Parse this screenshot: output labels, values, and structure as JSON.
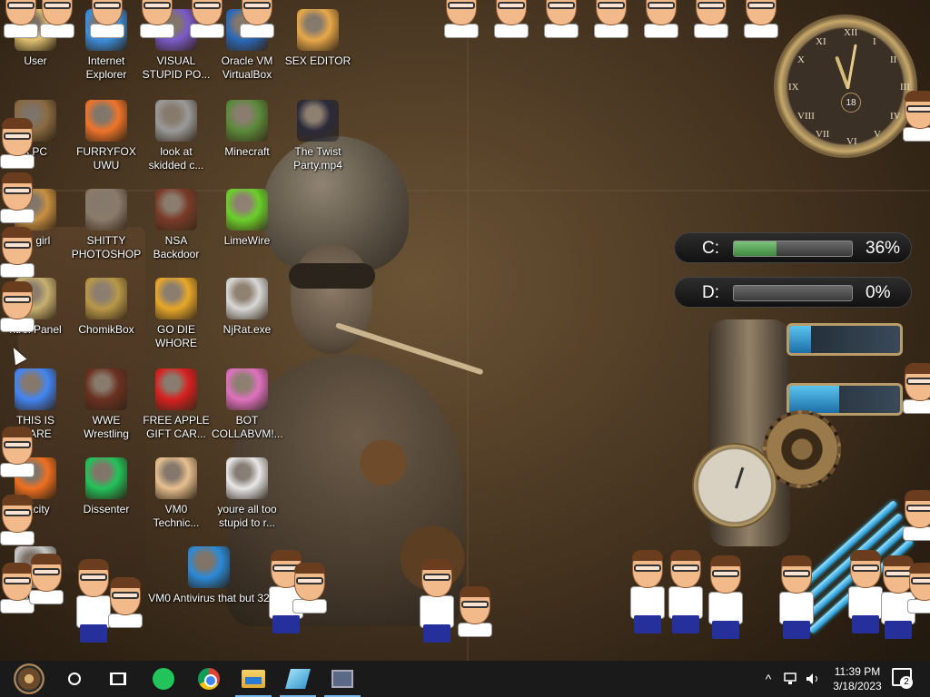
{
  "desktop": {
    "icons": [
      {
        "label": "User",
        "icon": "user-folder-icon",
        "color": "#e0c070"
      },
      {
        "label": "Internet\nExplorer",
        "icon": "internet-explorer-icon",
        "color": "#3c8fde"
      },
      {
        "label": "VISUAL\nSTUPID PO...",
        "icon": "visual-studio-icon",
        "color": "#7a5ac8"
      },
      {
        "label": "Oracle VM\nVirtualBox",
        "icon": "virtualbox-icon",
        "color": "#2a68b8"
      },
      {
        "label": "SEX EDITOR",
        "icon": "hex-editor-icon",
        "color": "#e8a848"
      },
      {
        "label": "s PC",
        "icon": "this-pc-icon",
        "color": "#8a6a40"
      },
      {
        "label": "FURRYFOX\nUWU",
        "icon": "firefox-icon",
        "color": "#f0742a"
      },
      {
        "label": "look at\nskidded c...",
        "icon": "copy-documents-icon",
        "color": "#9a9a9a"
      },
      {
        "label": "Minecraft",
        "icon": "minecraft-icon",
        "color": "#5a8a3a"
      },
      {
        "label": "The Twist\nParty.mp4",
        "icon": "video-file-icon",
        "color": "#2a2a3a"
      },
      {
        "label": "on girl",
        "icon": "cartoon-folder-icon",
        "color": "#c89040"
      },
      {
        "label": "SHITTY\nPHOTOSHOP",
        "icon": "gimp-icon",
        "color": "#8a7a6a"
      },
      {
        "label": "NSA\nBackdoor",
        "icon": "nsa-backdoor-icon",
        "color": "#7a3a28"
      },
      {
        "label": "LimeWire",
        "icon": "limewire-icon",
        "color": "#6ad02a"
      },
      {
        "label": "ntrol Panel",
        "icon": "control-panel-icon",
        "color": "#c8b070"
      },
      {
        "label": "ChomikBox",
        "icon": "chomikbox-icon",
        "color": "#b89848"
      },
      {
        "label": "GO DIE\nWHORE",
        "icon": "de-app-icon",
        "color": "#e8a828"
      },
      {
        "label": "NjRat.exe",
        "icon": "skull-icon",
        "color": "#d8d8d8"
      },
      {
        "label": "THIS IS\nWARE",
        "icon": "chrome-icon",
        "color": "#4285f4"
      },
      {
        "label": "WWE\nWrestling",
        "icon": "tv-icon",
        "color": "#6a3020"
      },
      {
        "label": "FREE APPLE\nGIFT CAR...",
        "icon": "apple-icon",
        "color": "#d82020"
      },
      {
        "label": "BOT\nCOLLABVM!...",
        "icon": "monitor-icon",
        "color": "#e070c0"
      },
      {
        "label": "dacity",
        "icon": "audacity-icon",
        "color": "#f07020"
      },
      {
        "label": "Dissenter",
        "icon": "dissenter-icon",
        "color": "#22c35a"
      },
      {
        "label": "VM0\nTechnic...",
        "icon": "technician-icon",
        "color": "#e8c090"
      },
      {
        "label": "youre all too\nstupid to r...",
        "icon": "portrait-image-icon",
        "color": "#e8e8e8"
      },
      {
        "label": "ALE",
        "icon": "partial-icon",
        "color": "#c8c8c8"
      },
      {
        "label": "VM0 Antivirus that but 32",
        "icon": "shield-icon",
        "color": "#2a8ad8"
      }
    ]
  },
  "widgets": {
    "clock": {
      "numerals": [
        "XII",
        "III",
        "VI",
        "IX",
        "I",
        "II",
        "IV",
        "V",
        "VII",
        "VIII",
        "X",
        "XI"
      ],
      "date_day": "18"
    },
    "drives": [
      {
        "label": "C:",
        "percent_text": "36%",
        "fill": 0.36
      },
      {
        "label": "D:",
        "percent_text": "0%",
        "fill": 0.0
      }
    ],
    "tubes": [
      {
        "level": 0.2
      },
      {
        "level": 0.45
      }
    ]
  },
  "taskbar": {
    "pinned": [
      {
        "name": "start-button",
        "icon": "start-orb-icon"
      },
      {
        "name": "cortana-button",
        "icon": "cortana-circle-icon"
      },
      {
        "name": "task-view-button",
        "icon": "task-view-icon"
      },
      {
        "name": "dissenter-taskbar",
        "icon": "dissenter-icon"
      },
      {
        "name": "chrome-taskbar",
        "icon": "chrome-icon"
      },
      {
        "name": "file-explorer-taskbar",
        "icon": "folder-icon"
      },
      {
        "name": "editor-taskbar",
        "icon": "pen-icon"
      },
      {
        "name": "vm-taskbar",
        "icon": "vm-window-icon"
      }
    ],
    "tray": {
      "chevron": "^",
      "time": "11:39 PM",
      "date": "3/18/2023",
      "notifications": "2"
    }
  },
  "colors": {
    "taskbar": "#1a1a1a",
    "accent": "#76b9ed",
    "drive_fill": "#5fa85f",
    "tube_liquid": "#3aa8e0"
  }
}
